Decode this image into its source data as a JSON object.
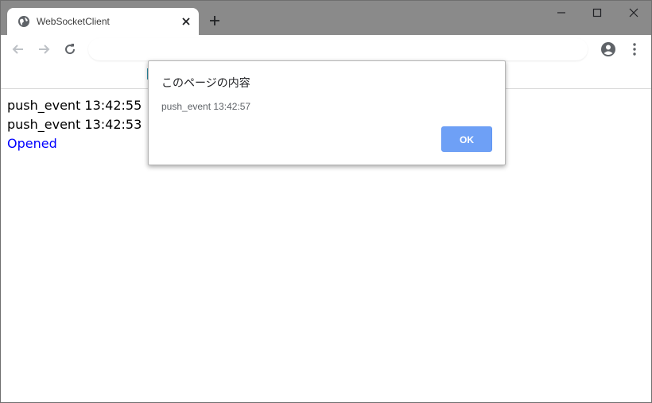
{
  "browser": {
    "tab": {
      "title": "WebSocketClient",
      "favicon": "globe-icon"
    },
    "address": "",
    "accent_color": "#2a8fa8"
  },
  "page": {
    "log": [
      {
        "text": "push_event 13:42:55",
        "color": "#000000"
      },
      {
        "text": "push_event 13:42:53",
        "color": "#000000"
      },
      {
        "text": "Opened",
        "color": "#0000ff"
      }
    ]
  },
  "alert": {
    "title": "このページの内容",
    "message": "push_event 13:42:57",
    "ok_label": "OK",
    "ok_color": "#6ea0f6"
  }
}
